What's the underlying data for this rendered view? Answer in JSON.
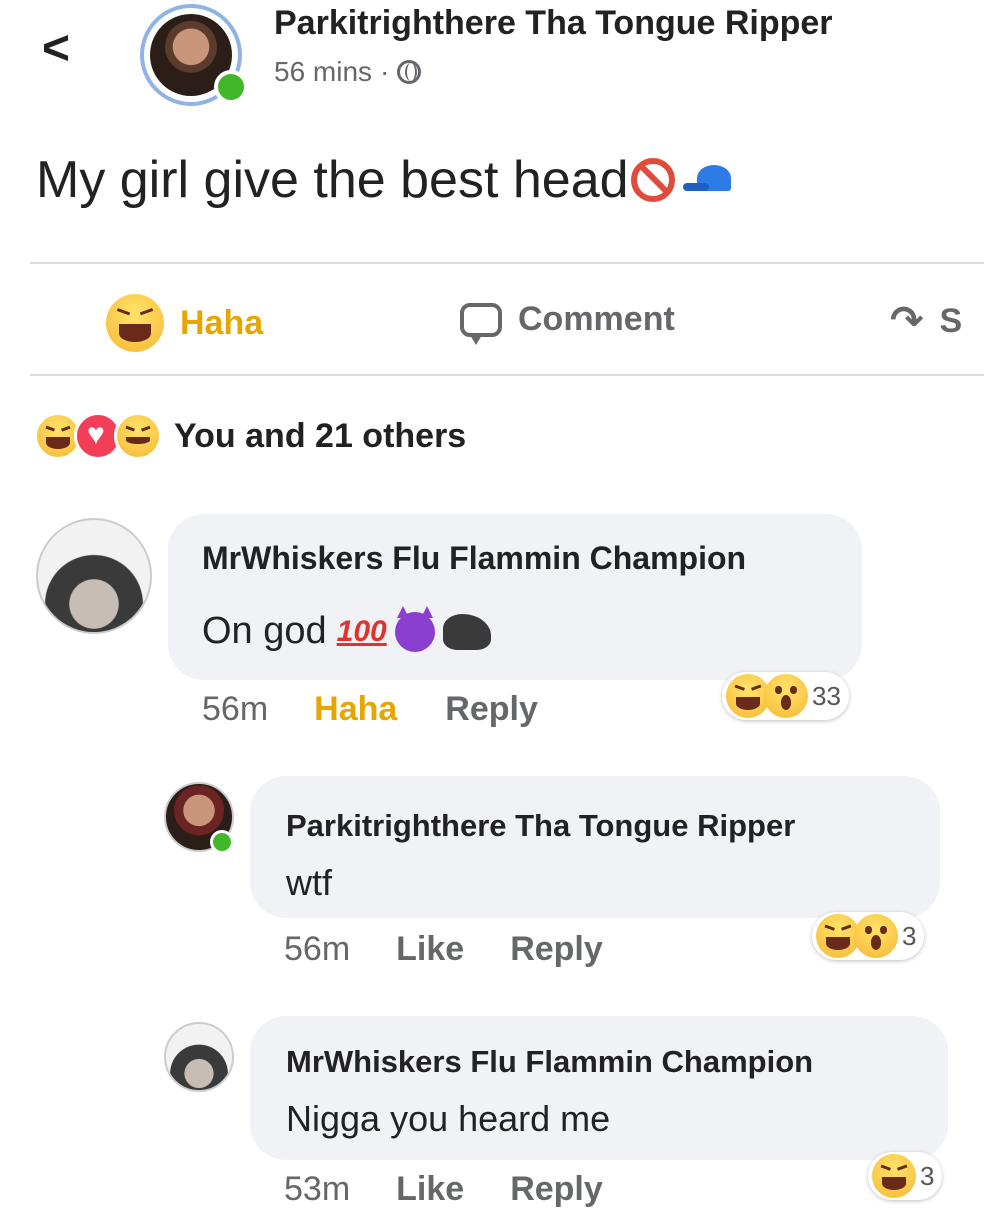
{
  "header": {
    "back_icon": "<",
    "author": "Parkitrighthere Tha Tongue Ripper",
    "time": "56 mins",
    "separator": "·"
  },
  "post": {
    "text": "My girl give the best head"
  },
  "actions": {
    "haha_label": "Haha",
    "comment_label": "Comment",
    "share_label": "S"
  },
  "reactions": {
    "summary": "You and 21 others"
  },
  "comments": [
    {
      "author": "MrWhiskers Flu Flammin Champion",
      "text": "On god",
      "hundred": "100",
      "time": "56m",
      "like_label": "Haha",
      "reply_label": "Reply",
      "reaction_count": "33"
    },
    {
      "author": "Parkitrighthere Tha Tongue Ripper",
      "text": "wtf",
      "time": "56m",
      "like_label": "Like",
      "reply_label": "Reply",
      "reaction_count": "3"
    },
    {
      "author": "MrWhiskers Flu Flammin Champion",
      "text": "Nigga you heard me",
      "time": "53m",
      "like_label": "Like",
      "reply_label": "Reply",
      "reaction_count": "3"
    }
  ],
  "colors": {
    "haha": "#e6a600",
    "online": "#42b72a",
    "bubble": "#f0f2f5",
    "muted": "#65676b"
  }
}
